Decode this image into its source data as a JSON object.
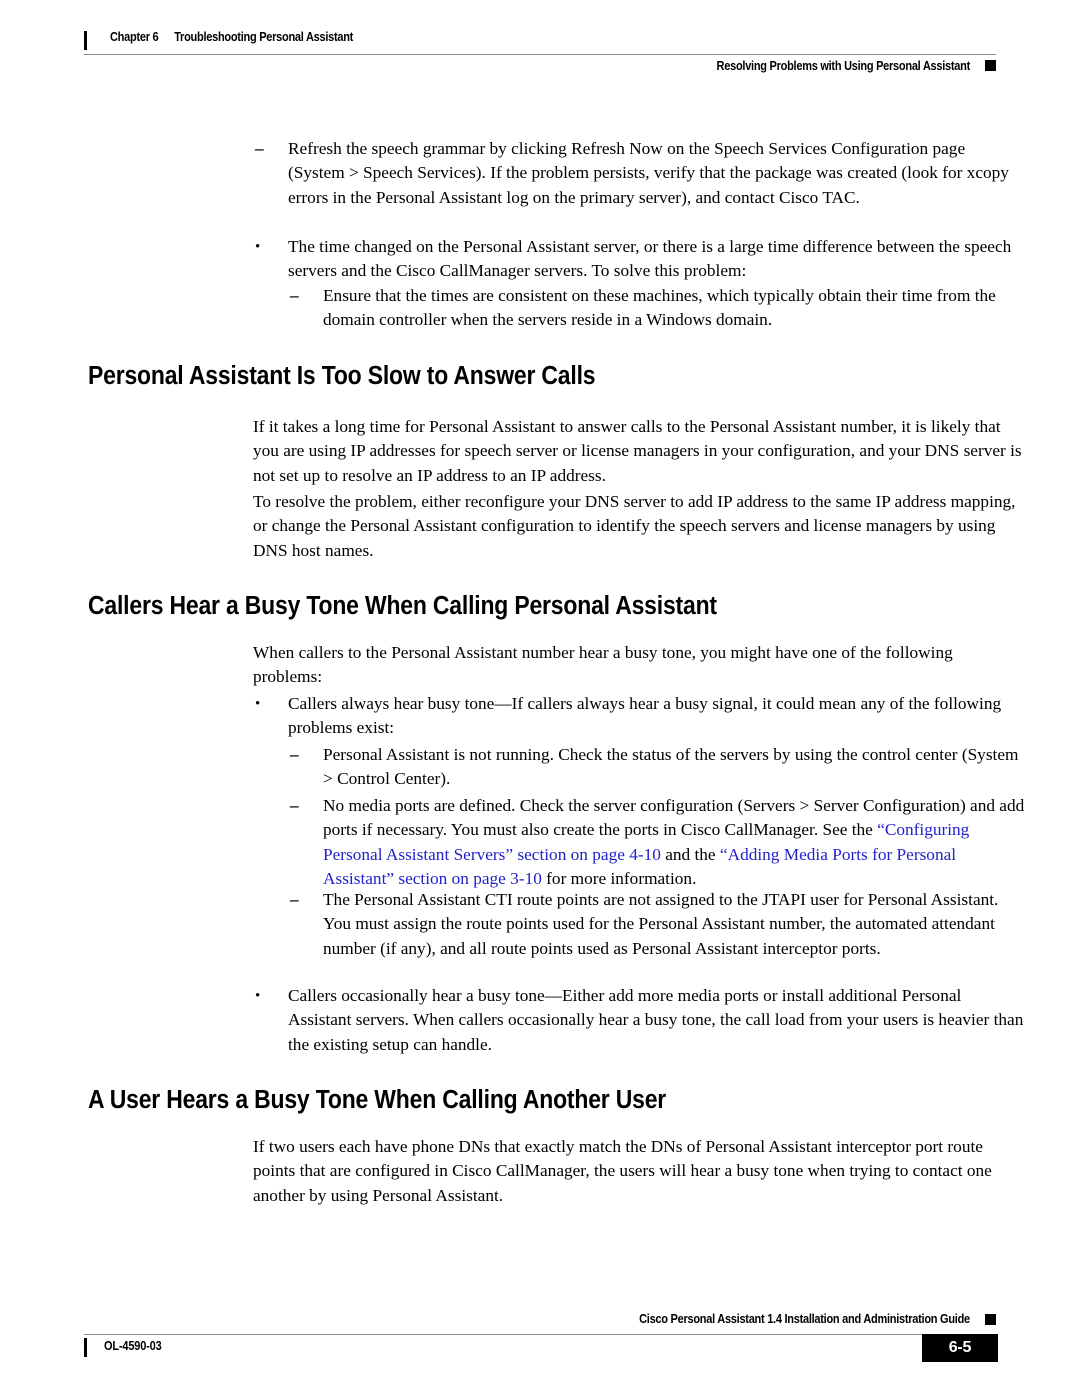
{
  "header": {
    "chapter_label": "Chapter 6",
    "chapter_title": "Troubleshooting Personal Assistant",
    "section_right": "Resolving Problems with Using Personal Assistant"
  },
  "footer": {
    "guide_title": "Cisco Personal Assistant 1.4 Installation and Administration Guide",
    "doc_id": "OL-4590-03",
    "page_number": "6-5"
  },
  "colors": {
    "link": "#2222cc",
    "text": "#000000",
    "rule": "#8d8d8d",
    "page_background": "#ffffff"
  },
  "markers": {
    "bullet": "•",
    "dash": "–"
  },
  "content": {
    "top_list": [
      {
        "marker": "dash",
        "text": "Refresh the speech grammar by clicking Refresh Now on the Speech Services Configuration page (System > Speech Services). If the problem persists, verify that the package was created (look for xcopy errors in the Personal Assistant log on the primary server), and contact Cisco TAC."
      },
      {
        "marker": "bullet",
        "text": "The time changed on the Personal Assistant server, or there is a large time difference between the speech servers and the Cisco CallManager servers. To solve this problem:"
      },
      {
        "marker": "dash",
        "text": "Ensure that the times are consistent on these machines, which typically obtain their time from the domain controller when the servers reside in a Windows domain."
      }
    ],
    "section_1": {
      "heading": "Personal Assistant Is Too Slow to Answer Calls",
      "paragraph_1": "If it takes a long time for Personal Assistant to answer calls to the Personal Assistant number, it is likely that you are using IP addresses for speech server or license managers in your configuration, and your DNS server is not set up to resolve an IP address to an IP address.",
      "paragraph_2": "To resolve the problem, either reconfigure your DNS server to add IP address to the same IP address mapping, or change the Personal Assistant configuration to identify the speech servers and license managers by using DNS host names."
    },
    "section_2": {
      "heading": "Callers Hear a Busy Tone When Calling Personal Assistant",
      "paragraph_1": "When callers to the Personal Assistant number hear a busy tone, you might have one of the following problems:",
      "bullet_1": "Callers always hear busy tone—If callers always hear a busy signal, it could mean any of the following problems exist:",
      "dash_1": "Personal Assistant is not running. Check the status of the servers by using the control center (System > Control Center).",
      "dash_2_part_1": "No media ports are defined. Check the server configuration (Servers > Server Configuration) and add ports if necessary. You must also create the ports in Cisco CallManager. See the ",
      "dash_2_link_1": "“Configuring Personal Assistant Servers” section on page 4-10",
      "dash_2_part_2": " and the ",
      "dash_2_link_2": "“Adding Media Ports for Personal Assistant” section on page 3-10",
      "dash_2_part_3": " for more information.",
      "dash_3": "The Personal Assistant CTI route points are not assigned to the JTAPI user for Personal Assistant. You must assign the route points used for the Personal Assistant number, the automated attendant number (if any), and all route points used as Personal Assistant interceptor ports.",
      "bullet_2": "Callers occasionally hear a busy tone—Either add more media ports or install additional Personal Assistant servers. When callers occasionally hear a busy tone, the call load from your users is heavier than the existing setup can handle."
    },
    "section_3": {
      "heading": "A User Hears a Busy Tone When Calling Another User",
      "paragraph_1": "If two users each have phone DNs that exactly match the DNs of Personal Assistant interceptor port route points that are configured in Cisco CallManager, the users will hear a busy tone when trying to contact one another by using Personal Assistant."
    }
  }
}
